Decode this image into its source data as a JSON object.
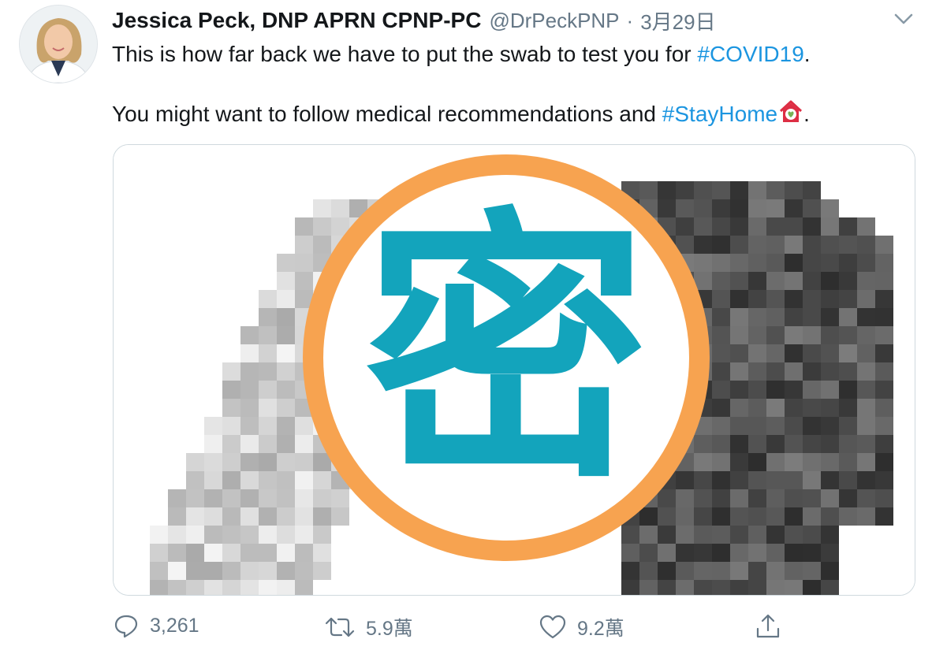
{
  "tweet": {
    "author_name": "Jessica Peck, DNP APRN CPNP-PC",
    "handle": "@DrPeckPNP",
    "separator": "·",
    "date": "3月29日",
    "line1_text": "This is how far back we have to put the swab to test you for ",
    "line1_hashtag": "#COVID19",
    "line1_end": ".",
    "line2_text": "You might want to follow medical recommendations and ",
    "line2_hashtag": "#StayHome",
    "line2_end": "."
  },
  "media": {
    "overlay_character": "密",
    "overlay_ring_color": "#f7a350",
    "overlay_glyph_color": "#13a4bc"
  },
  "actions": {
    "reply_count": "3,261",
    "retweet_count": "5.9萬",
    "like_count": "9.2萬"
  },
  "icons": [
    "avatar",
    "chevron-down-icon",
    "house-with-heart-emoji",
    "reply-icon",
    "retweet-icon",
    "like-icon",
    "share-icon"
  ],
  "colors": {
    "hashtag": "#1b95e0",
    "secondary_text": "#657786"
  }
}
